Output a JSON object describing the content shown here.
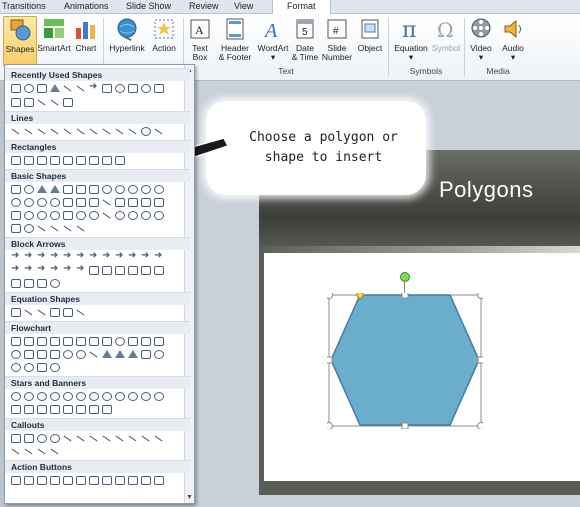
{
  "tabs": [
    "Transitions",
    "Animations",
    "Slide Show",
    "Review",
    "View",
    "Format"
  ],
  "ribbon": {
    "shapes": "Shapes",
    "smartart": "SmartArt",
    "chart": "Chart",
    "hyperlink": "Hyperlink",
    "action": "Action",
    "textbox": [
      "Text",
      "Box"
    ],
    "header_footer": [
      "Header",
      "& Footer"
    ],
    "wordart": "WordArt",
    "date_time": [
      "Date",
      "& Time"
    ],
    "slide_number": [
      "Slide",
      "Number"
    ],
    "object": "Object",
    "equation": "Equation",
    "symbol": "Symbol",
    "video": "Video",
    "audio": "Audio",
    "groups": {
      "text": "Text",
      "symbols": "Symbols",
      "media": "Media"
    }
  },
  "gallery": {
    "sections": [
      "Recently Used Shapes",
      "Lines",
      "Rectangles",
      "Basic Shapes",
      "Block Arrows",
      "Equation Shapes",
      "Flowchart",
      "Stars and Banners",
      "Callouts",
      "Action Buttons"
    ]
  },
  "callout": {
    "line1": "Choose a polygon or",
    "line2": "shape to insert"
  },
  "slide": {
    "title": "Polygons"
  },
  "colors": {
    "hexagon_fill": "#6aaecb",
    "rotation_handle": "#7ed957",
    "adjust_handle": "#f6d743"
  }
}
